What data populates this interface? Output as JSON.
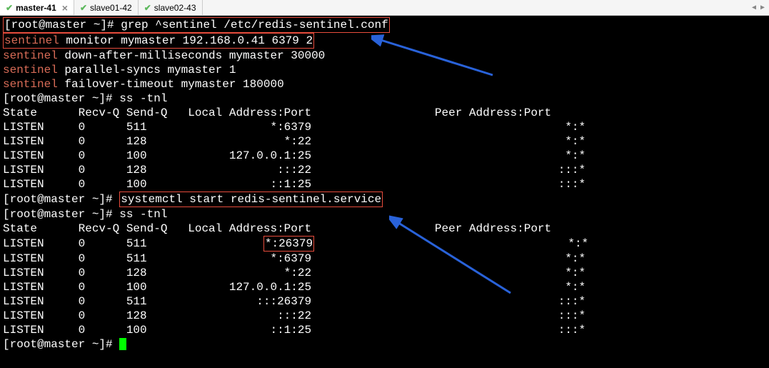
{
  "tabs": [
    {
      "label": "master-41",
      "active": true,
      "closable": true
    },
    {
      "label": "slave01-42",
      "active": false,
      "closable": false
    },
    {
      "label": "slave02-43",
      "active": false,
      "closable": false
    }
  ],
  "prompt": {
    "user": "root",
    "host": "master",
    "path": "~",
    "symbol": "#"
  },
  "commands": {
    "grep": "grep ^sentinel /etc/redis-sentinel.conf",
    "ss1": "ss -tnl",
    "systemctl": "systemctl start redis-sentinel.service",
    "ss2": "ss -tnl"
  },
  "sentinel_lines": [
    {
      "kw": "sentinel",
      "rest": " monitor mymaster 192.168.0.41 6379 2"
    },
    {
      "kw": "sentinel",
      "rest": " down-after-milliseconds mymaster 30000"
    },
    {
      "kw": "sentinel",
      "rest": " parallel-syncs mymaster 1"
    },
    {
      "kw": "sentinel",
      "rest": " failover-timeout mymaster 180000"
    }
  ],
  "ss_header": "State      Recv-Q Send-Q   Local Address:Port                  Peer Address:Port",
  "ss1_rows": [
    {
      "state": "LISTEN",
      "recvq": "0",
      "sendq": "511",
      "local": "*:6379",
      "peer": "*:*"
    },
    {
      "state": "LISTEN",
      "recvq": "0",
      "sendq": "128",
      "local": "*:22",
      "peer": "*:*"
    },
    {
      "state": "LISTEN",
      "recvq": "0",
      "sendq": "100",
      "local": "127.0.0.1:25",
      "peer": "*:*"
    },
    {
      "state": "LISTEN",
      "recvq": "0",
      "sendq": "128",
      "local": ":::22",
      "peer": ":::*"
    },
    {
      "state": "LISTEN",
      "recvq": "0",
      "sendq": "100",
      "local": "::1:25",
      "peer": ":::*"
    }
  ],
  "ss2_rows": [
    {
      "state": "LISTEN",
      "recvq": "0",
      "sendq": "511",
      "local": "*:26379",
      "peer": "*:*",
      "boxed": true
    },
    {
      "state": "LISTEN",
      "recvq": "0",
      "sendq": "511",
      "local": "*:6379",
      "peer": "*:*"
    },
    {
      "state": "LISTEN",
      "recvq": "0",
      "sendq": "128",
      "local": "*:22",
      "peer": "*:*"
    },
    {
      "state": "LISTEN",
      "recvq": "0",
      "sendq": "100",
      "local": "127.0.0.1:25",
      "peer": "*:*"
    },
    {
      "state": "LISTEN",
      "recvq": "0",
      "sendq": "511",
      "local": ":::26379",
      "peer": ":::*"
    },
    {
      "state": "LISTEN",
      "recvq": "0",
      "sendq": "128",
      "local": ":::22",
      "peer": ":::*"
    },
    {
      "state": "LISTEN",
      "recvq": "0",
      "sendq": "100",
      "local": "::1:25",
      "peer": ":::*"
    }
  ],
  "highlight": {
    "sentinel_line_box": 0,
    "systemctl_box": true,
    "port_box": "*:26379"
  }
}
